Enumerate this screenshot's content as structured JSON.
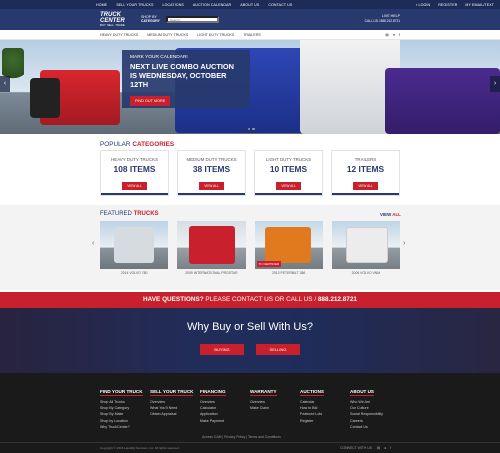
{
  "topnav": {
    "links": [
      "HOME",
      "SELL YOUR TRUCKS",
      "LOCATIONS",
      "AUCTION CALENDAR",
      "ABOUT US",
      "CONTACT US"
    ],
    "login": "LOGIN",
    "register": "REGISTER",
    "email_list": "MY EMAIL/TEXT"
  },
  "header": {
    "logo_line1": "TRUCK CENTER",
    "logo_line2": "BUY. SELL. TRADE",
    "shop_by": "SHOP BY",
    "category": "CATEGORY",
    "search_placeholder": "Search...",
    "live_help": "LIVE HELP",
    "call_us": "CALL US / 888.212.8721"
  },
  "subnav": {
    "items": [
      "HEAVY DUTY TRUCKS",
      "MEDIUM DUTY TRUCKS",
      "LIGHT DUTY TRUCKS",
      "TRAILERS"
    ],
    "icons": [
      "rss-icon",
      "twitter-icon",
      "facebook-icon"
    ]
  },
  "hero": {
    "kicker": "MARK YOUR CALENDAR!",
    "title": "NEXT LIVE COMBO AUCTION IS WEDNESDAY, OCTOBER 12TH",
    "button": "FIND OUT MORE",
    "slides": 3,
    "active_slide": 1
  },
  "popular": {
    "title_a": "POPULAR",
    "title_b": "CATEGORIES",
    "cards": [
      {
        "name": "HEAVY DUTY TRUCKS",
        "count": "108 ITEMS",
        "button": "VIEW ALL"
      },
      {
        "name": "MEDIUM DUTY TRUCKS",
        "count": "38 ITEMS",
        "button": "VIEW ALL"
      },
      {
        "name": "LIGHT DUTY TRUCKS",
        "count": "10 ITEMS",
        "button": "VIEW ALL"
      },
      {
        "name": "TRAILERS",
        "count": "12 ITEMS",
        "button": "VIEW ALL"
      }
    ]
  },
  "featured": {
    "title_a": "FEATURED",
    "title_b": "TRUCKS",
    "view": "VIEW",
    "all": "ALL",
    "items": [
      {
        "caption": "2014 VOLVO 780",
        "color": "#cfd4da"
      },
      {
        "caption": "2009 INTERNATIONAL PROSTAR",
        "color": "#c8202d"
      },
      {
        "caption": "2013 PETERBILT 386",
        "color": "#e07a1f",
        "badge": "TC CERTIFIED"
      },
      {
        "caption": "2006 VOLVO VNM",
        "color": "#e8e8e8"
      }
    ]
  },
  "questions": {
    "bold": "HAVE QUESTIONS?",
    "rest": " PLEASE CONTACT US OR CALL US / ",
    "phone": "888.212.8721"
  },
  "why": {
    "heading": "Why Buy or Sell With Us?",
    "buying": "BUYING",
    "selling": "SELLING"
  },
  "footer": {
    "columns": [
      {
        "heading": "FIND YOUR TRUCK",
        "items": [
          "Shop All Trucks",
          "Shop By Category",
          "Shop By Make",
          "Shop by Location",
          "Why TruckCenter?"
        ]
      },
      {
        "heading": "SELL YOUR TRUCK",
        "items": [
          "Overview",
          "What You'll Need",
          "Obtain Appraisal"
        ]
      },
      {
        "heading": "FINANCING",
        "items": [
          "Overview",
          "Calculator",
          "Application",
          "Make Payment"
        ]
      },
      {
        "heading": "WARRANTY",
        "items": [
          "Overview",
          "Make Claim"
        ]
      },
      {
        "heading": "AUCTIONS",
        "items": [
          "Calendar",
          "How to Bid",
          "Featured Lots",
          "Register"
        ]
      },
      {
        "heading": "ABOUT US",
        "items": [
          "Who We Are",
          "Our Culture",
          "Social Responsibility",
          "Careers",
          "Contact Us"
        ]
      }
    ],
    "copyright": "Copyright © 2016 Liquidity Services, Inc. All rights reserved.",
    "links": "Access CAM  |  Privacy Policy  |  Terms and Conditions",
    "connect": "CONNECT WITH US"
  },
  "colors": {
    "navy": "#27396d",
    "red": "#c8202d",
    "dark": "#1a1a1a"
  }
}
